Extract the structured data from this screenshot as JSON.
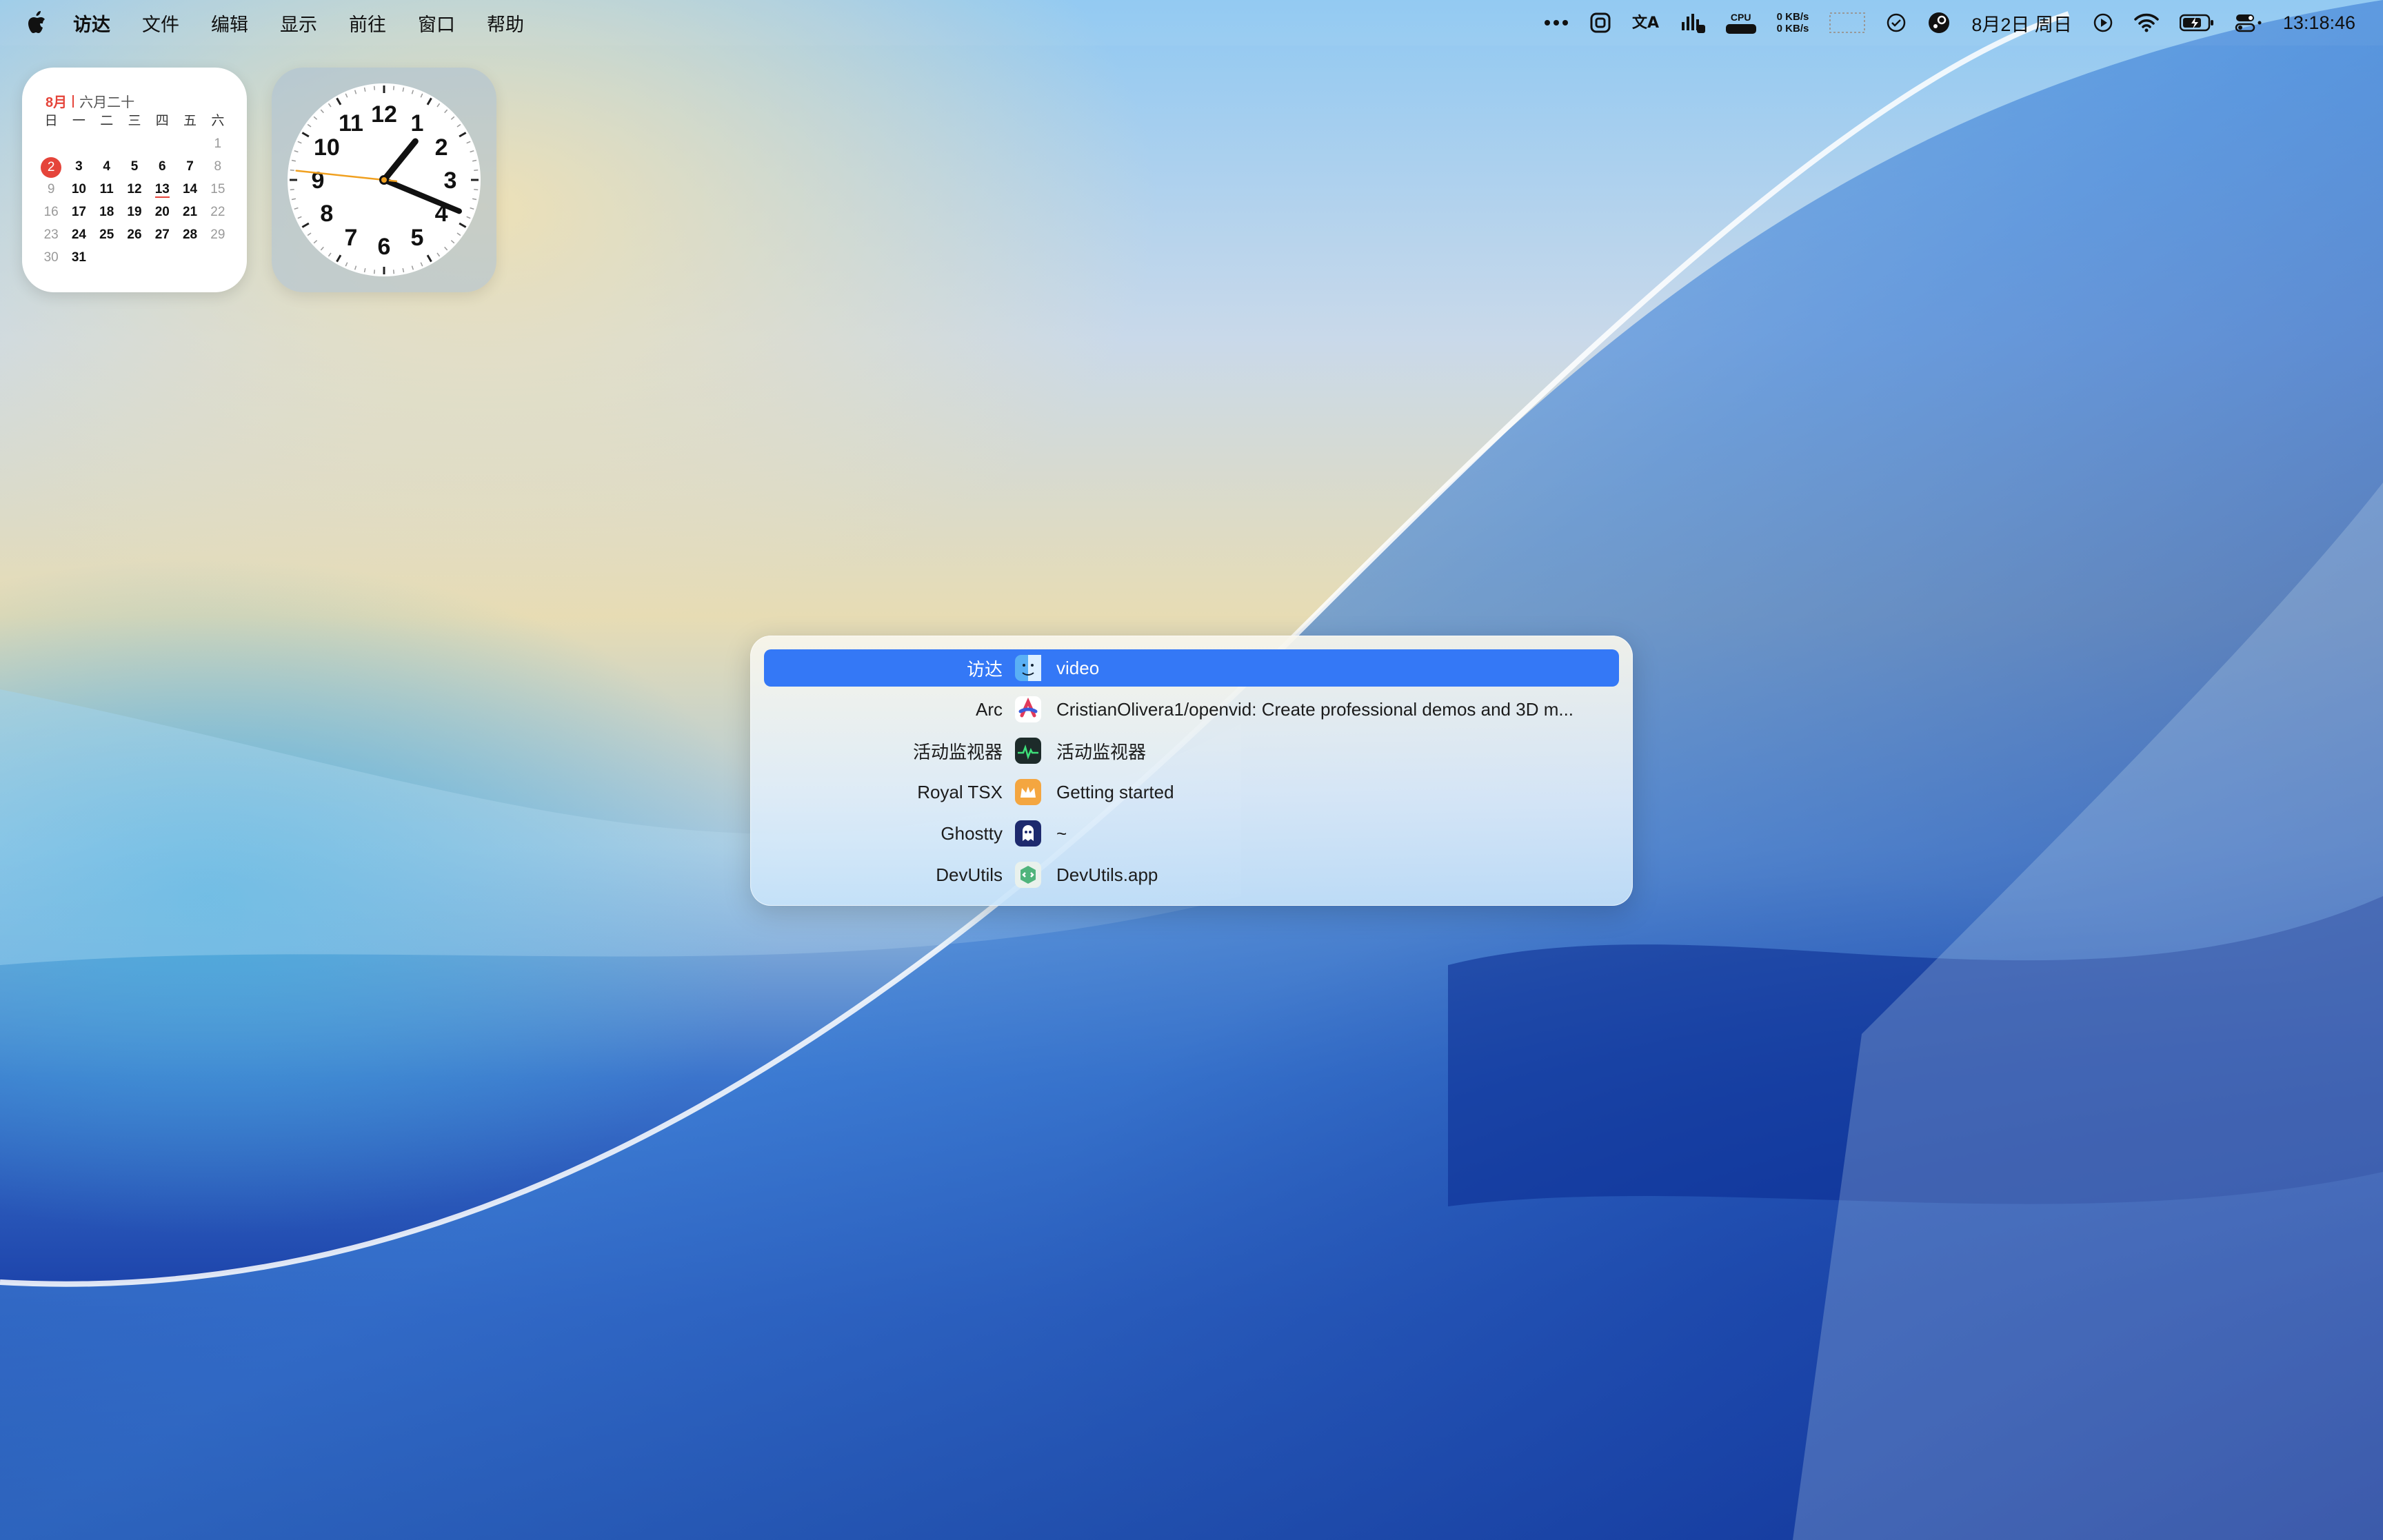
{
  "menubar": {
    "app_name": "访达",
    "menus": [
      "文件",
      "编辑",
      "显示",
      "前往",
      "窗口",
      "帮助"
    ],
    "cpu_label": "CPU",
    "net_up": "0 KB/s",
    "net_down": "0 KB/s",
    "date": "8月2日 周日",
    "time": "13:18:46",
    "tray_icons": [
      "more-icon",
      "screenshot-icon",
      "input-method-icon",
      "audio-icon",
      "cpu-meter-icon",
      "network-speed-icon",
      "check-icon",
      "steam-icon",
      "play-icon",
      "wifi-icon",
      "battery-icon",
      "control-center-icon"
    ]
  },
  "calendar": {
    "month": "8月",
    "lunar": "六月二十",
    "weekdays": [
      "日",
      "一",
      "二",
      "三",
      "四",
      "五",
      "六"
    ],
    "today": "2",
    "event_day": "13",
    "weeks": [
      [
        "",
        "",
        "",
        "",
        "",
        "",
        "1"
      ],
      [
        "2",
        "3",
        "4",
        "5",
        "6",
        "7",
        "8"
      ],
      [
        "9",
        "10",
        "11",
        "12",
        "13",
        "14",
        "15"
      ],
      [
        "16",
        "17",
        "18",
        "19",
        "20",
        "21",
        "22"
      ],
      [
        "23",
        "24",
        "25",
        "26",
        "27",
        "28",
        "29"
      ],
      [
        "30",
        "31",
        "",
        "",
        "",
        "",
        ""
      ]
    ]
  },
  "clock": {
    "numbers": [
      "12",
      "1",
      "2",
      "3",
      "4",
      "5",
      "6",
      "7",
      "8",
      "9",
      "10",
      "11"
    ],
    "time": {
      "hours": 13,
      "minutes": 18,
      "seconds": 46
    },
    "second_hand_color": "#f0a020"
  },
  "switcher": {
    "rows": [
      {
        "app": "访达",
        "title": "video",
        "icon": "finder-icon",
        "selected": true
      },
      {
        "app": "Arc",
        "title": "CristianOlivera1/openvid: Create professional demos and 3D m...",
        "icon": "arc-icon",
        "selected": false
      },
      {
        "app": "活动监视器",
        "title": "活动监视器",
        "icon": "activity-monitor-icon",
        "selected": false
      },
      {
        "app": "Royal TSX",
        "title": "Getting started",
        "icon": "royal-tsx-icon",
        "selected": false
      },
      {
        "app": "Ghostty",
        "title": "~",
        "icon": "ghostty-icon",
        "selected": false
      },
      {
        "app": "DevUtils",
        "title": "DevUtils.app",
        "icon": "devutils-icon",
        "selected": false
      }
    ]
  },
  "colors": {
    "selection": "#3478f6",
    "calendar_accent": "#e5443a"
  }
}
